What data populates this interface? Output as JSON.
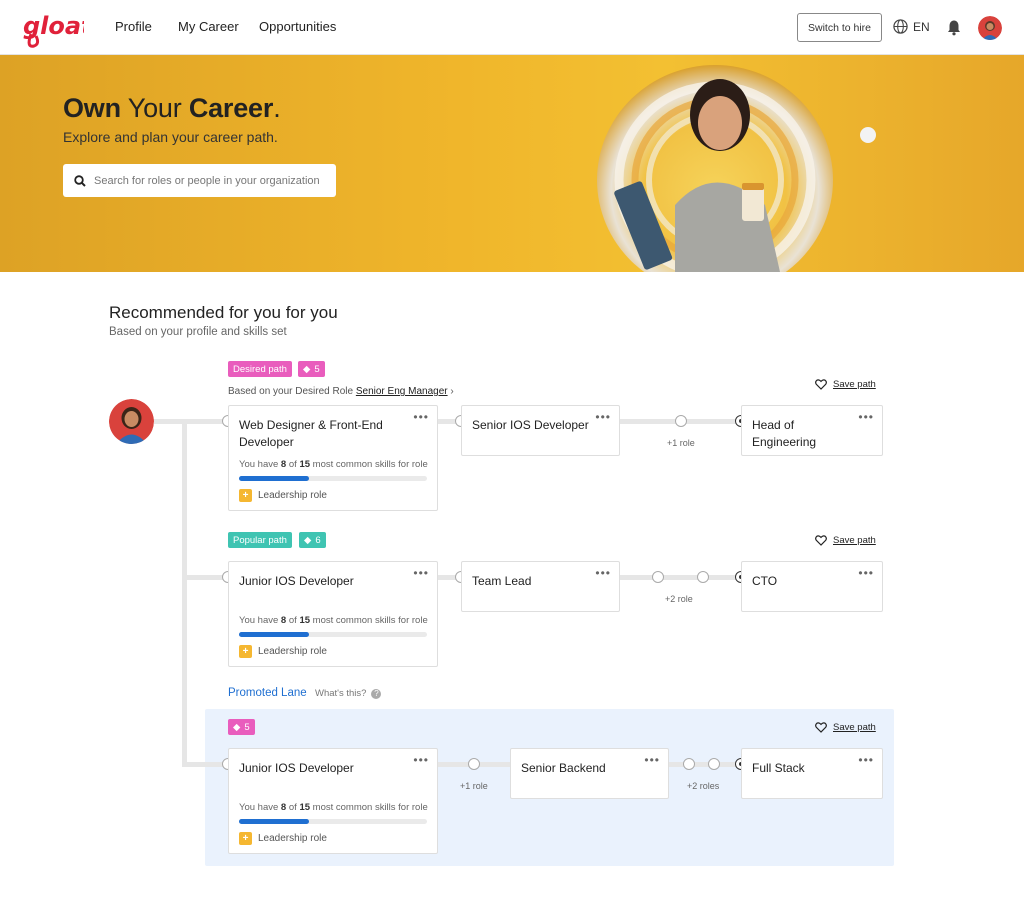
{
  "header": {
    "brand": "gloat",
    "nav": [
      "Profile",
      "My Career",
      "Opportunities"
    ],
    "switch_label": "Switch to hire",
    "language": "EN",
    "brand_color": "#e0213a"
  },
  "hero": {
    "title_bold_1": "Own",
    "title_light": "Your",
    "title_bold_2": "Career",
    "title_punct": ".",
    "subtitle": "Explore and plan your career path.",
    "search_placeholder": "Search for roles or people in your organization"
  },
  "section": {
    "title": "Recommended for you for you",
    "subtitle": "Based on your profile and skills set"
  },
  "paths": [
    {
      "tag_label": "Desired path",
      "tag_count": "5",
      "based_on": "Based on your Desired Role",
      "desired_role": "Senior Eng Manager",
      "save_label": "Save path",
      "first_card": {
        "title_line1": "Web Designer & Front-End",
        "title_line2": "Developer",
        "skills_prefix": "You have",
        "skills_have": "8",
        "skills_of": "of",
        "skills_total": "15",
        "skills_suffix": "most common skills for role",
        "skills_fraction": 0.37,
        "leadership": "Leadership role"
      },
      "mid_card": "Senior IOS Developer",
      "mid_gap": "+1 role",
      "end_card_line1": "Head of",
      "end_card_line2": "Engineering"
    },
    {
      "tag_label": "Popular path",
      "tag_count": "6",
      "save_label": "Save path",
      "first_card": {
        "title_line1": "Junior IOS Developer",
        "skills_prefix": "You have",
        "skills_have": "8",
        "skills_of": "of",
        "skills_total": "15",
        "skills_suffix": "most common skills for role",
        "skills_fraction": 0.37,
        "leadership": "Leadership role"
      },
      "mid_card": "Team Lead",
      "mid_gap": "+2 role",
      "end_card_line1": "CTO"
    },
    {
      "lane_label": "Promoted Lane",
      "lane_help": "What's this?",
      "tag_count": "5",
      "save_label": "Save path",
      "first_card": {
        "title_line1": "Junior IOS Developer",
        "skills_prefix": "You have",
        "skills_have": "8",
        "skills_of": "of",
        "skills_total": "15",
        "skills_suffix": "most common skills for role",
        "skills_fraction": 0.37,
        "leadership": "Leadership role"
      },
      "first_gap": "+1 role",
      "mid_card": "Senior Backend",
      "mid_gap": "+2 roles",
      "end_card_line1": "Full Stack"
    }
  ],
  "icons": {
    "search": "search-icon",
    "globe": "globe-icon",
    "bell": "bell-icon",
    "heart": "heart-icon",
    "more": "more-icon",
    "leadership": "star-icon"
  },
  "colors": {
    "accent_blue": "#1f6fd1",
    "tag_pink": "#e95dbd",
    "tag_teal": "#3fc4b2",
    "hero_yellow": "#f0b62b"
  }
}
